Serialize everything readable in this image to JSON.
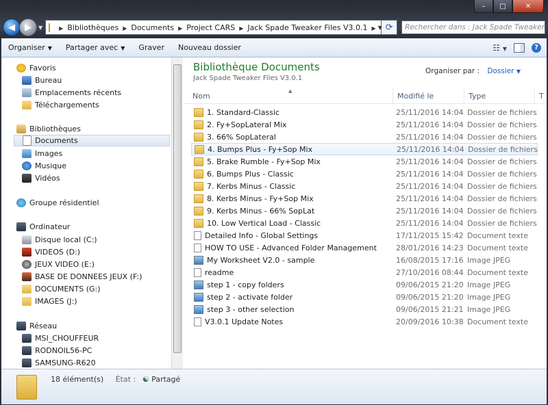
{
  "window": {
    "caption_minimize": "–",
    "caption_maximize": "□",
    "caption_close": "✕"
  },
  "nav": {
    "back_icon": "back-arrow-icon",
    "forward_icon": "forward-arrow-icon",
    "breadcrumbs": [
      "Bibliothèques",
      "Documents",
      "Project CARS",
      "Jack Spade Tweaker Files V3.0.1"
    ],
    "search_placeholder": "Rechercher dans : Jack Spade Tweaker..."
  },
  "toolbar": {
    "organize": "Organiser",
    "share": "Partager avec",
    "burn": "Graver",
    "new_folder": "Nouveau dossier"
  },
  "navpane": {
    "favorites_header": "Favoris",
    "favorites": [
      "Bureau",
      "Emplacements récents",
      "Téléchargements"
    ],
    "libraries_header": "Bibliothèques",
    "libraries": [
      "Documents",
      "Images",
      "Musique",
      "Vidéos"
    ],
    "homegroup": "Groupe résidentiel",
    "computer_header": "Ordinateur",
    "drives": [
      "Disque local (C:)",
      "VIDEOS (D:)",
      "JEUX VIDEO (E:)",
      "BASE DE DONNEES JEUX (F:)",
      "DOCUMENTS (G:)",
      "IMAGES (J:)"
    ],
    "network_header": "Réseau",
    "network": [
      "MSI_CHOUFFEUR",
      "RODNOIL56-PC",
      "SAMSUNG-R620"
    ]
  },
  "content": {
    "library_title": "Bibliothèque Documents",
    "library_subtitle": "Jack Spade Tweaker Files V3.0.1",
    "arrange_label": "Organiser par :",
    "arrange_value": "Dossier",
    "columns": [
      "Nom",
      "Modifié le",
      "Type",
      "T"
    ],
    "files": [
      {
        "name": "1. Standard-Classic",
        "date": "25/11/2016 14:04",
        "type": "Dossier de fichiers",
        "icon": "folder"
      },
      {
        "name": "2. Fy+SopLateral Mix",
        "date": "25/11/2016 14:04",
        "type": "Dossier de fichiers",
        "icon": "folder"
      },
      {
        "name": "3.  66% SopLateral",
        "date": "25/11/2016 14:04",
        "type": "Dossier de fichiers",
        "icon": "folder"
      },
      {
        "name": "4. Bumps Plus - Fy+Sop Mix",
        "date": "25/11/2016 14:04",
        "type": "Dossier de fichiers",
        "icon": "folder"
      },
      {
        "name": "5. Brake Rumble - Fy+Sop Mix",
        "date": "25/11/2016 14:04",
        "type": "Dossier de fichiers",
        "icon": "folder"
      },
      {
        "name": "6. Bumps Plus - Classic",
        "date": "25/11/2016 14:04",
        "type": "Dossier de fichiers",
        "icon": "folder"
      },
      {
        "name": "7. Kerbs Minus - Classic",
        "date": "25/11/2016 14:04",
        "type": "Dossier de fichiers",
        "icon": "folder"
      },
      {
        "name": "8. Kerbs Minus - Fy+Sop Mix",
        "date": "25/11/2016 14:04",
        "type": "Dossier de fichiers",
        "icon": "folder"
      },
      {
        "name": "9. Kerbs Minus - 66% SopLat",
        "date": "25/11/2016 14:04",
        "type": "Dossier de fichiers",
        "icon": "folder"
      },
      {
        "name": "10. Low Vertical Load - Classic",
        "date": "25/11/2016 14:04",
        "type": "Dossier de fichiers",
        "icon": "folder"
      },
      {
        "name": "Detailed Info - Global Settings",
        "date": "17/11/2015 15:42",
        "type": "Document texte",
        "icon": "text"
      },
      {
        "name": "HOW TO USE - Advanced Folder Management",
        "date": "28/01/2016 14:23",
        "type": "Document texte",
        "icon": "text"
      },
      {
        "name": "My Worksheet V2.0 - sample",
        "date": "16/08/2015 17:16",
        "type": "Image JPEG",
        "icon": "image"
      },
      {
        "name": "readme",
        "date": "27/10/2016 08:44",
        "type": "Document texte",
        "icon": "text"
      },
      {
        "name": "step 1 - copy folders",
        "date": "09/06/2015 21:20",
        "type": "Image JPEG",
        "icon": "image"
      },
      {
        "name": "step 2 - activate folder",
        "date": "09/06/2015 21:20",
        "type": "Image JPEG",
        "icon": "image"
      },
      {
        "name": "step 3 - other selection",
        "date": "09/06/2015 21:21",
        "type": "Image JPEG",
        "icon": "image"
      },
      {
        "name": "V3.0.1  Update Notes",
        "date": "20/09/2016 10:38",
        "type": "Document texte",
        "icon": "text"
      }
    ]
  },
  "status": {
    "count": "18 élément(s)",
    "state_label": "État :",
    "state_value": "Partagé"
  }
}
